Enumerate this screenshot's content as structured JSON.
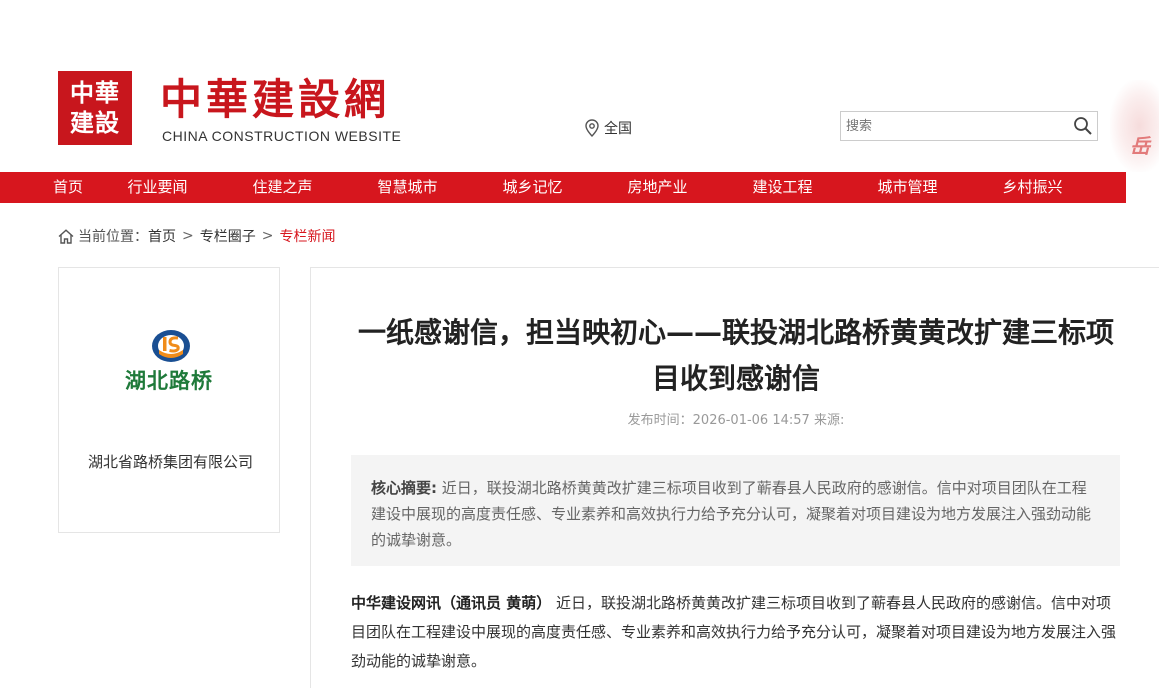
{
  "header": {
    "seal_line1": "中華",
    "seal_line2": "建設",
    "site_name_cn": "中華建設網",
    "site_name_en": "CHINA CONSTRUCTION WEBSITE",
    "region": "全国",
    "search_placeholder": "搜索",
    "corner_text": "岳"
  },
  "nav": {
    "items": [
      "首页",
      "行业要闻",
      "住建之声",
      "智慧城市",
      "城乡记忆",
      "房地产业",
      "建设工程",
      "城市管理",
      "乡村振兴"
    ]
  },
  "breadcrumb": {
    "prefix": "当前位置：",
    "items": [
      "首页",
      "专栏圈子",
      "专栏新闻"
    ],
    "sep": ">"
  },
  "sidebar": {
    "logo_text": "湖北路桥",
    "company_name": "湖北省路桥集团有限公司"
  },
  "article": {
    "title": "一纸感谢信，担当映初心——联投湖北路桥黄黄改扩建三标项目收到感谢信",
    "meta_prefix": "发布时间：",
    "publish_time": "2026-01-06 14:57",
    "source_label": "来源:",
    "summary_label": "核心摘要:",
    "summary_text": "近日，联投湖北路桥黄黄改扩建三标项目收到了蕲春县人民政府的感谢信。信中对项目团队在工程建设中展现的高度责任感、专业素养和高效执行力给予充分认可，凝聚着对项目建设为地方发展注入强劲动能的诚挚谢意。",
    "lead_bold": "中华建设网讯（通讯员 黄萌）",
    "body_text": "近日，联投湖北路桥黄黄改扩建三标项目收到了蕲春县人民政府的感谢信。信中对项目团队在工程建设中展现的高度责任感、专业素养和高效执行力给予充分认可，凝聚着对项目建设为地方发展注入强劲动能的诚挚谢意。"
  },
  "colors": {
    "brand_red": "#d7161e",
    "logo_green": "#1f7a3a",
    "logo_blue": "#1a4f93",
    "logo_orange": "#f08c1a"
  }
}
